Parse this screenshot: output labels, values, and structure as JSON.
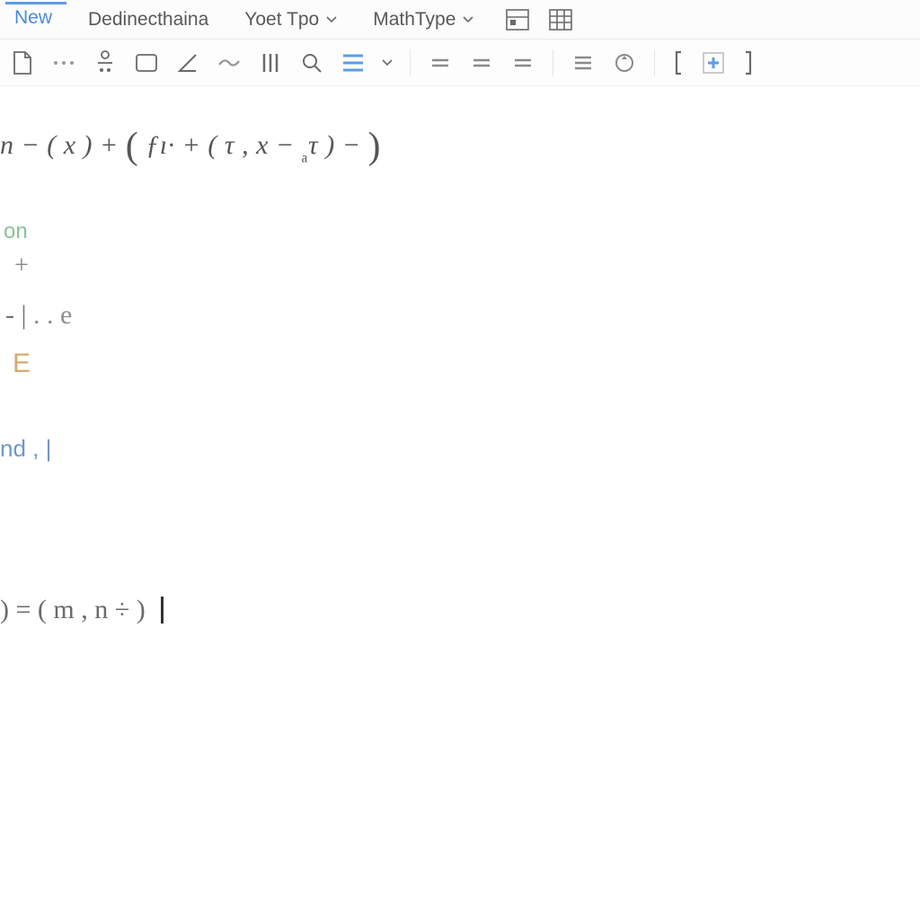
{
  "menubar": {
    "items": [
      {
        "label": "New",
        "active": true,
        "has_dropdown": false
      },
      {
        "label": "Dedinecthaina",
        "active": false,
        "has_dropdown": false
      },
      {
        "label": "Yoet Tpo",
        "active": false,
        "has_dropdown": true
      },
      {
        "label": "MathType",
        "active": false,
        "has_dropdown": true
      }
    ],
    "right_icons": [
      "insert-row-icon",
      "table-grid-icon"
    ]
  },
  "toolbar": {
    "buttons": [
      "new-doc-icon",
      "ellipsis-icon",
      "fraction-icon",
      "bracket-icon",
      "angle-icon",
      "tilde-icon",
      "matrix-bars-icon",
      "zoom-icon",
      "align-lines-icon",
      "dropdown-caret-icon",
      "sep",
      "eq1-icon",
      "eq2-icon",
      "eq3-icon",
      "sep",
      "triple-bar-icon",
      "circle-arrow-icon",
      "sep",
      "left-bracket-icon",
      "plus-box-icon",
      "right-bracket-icon"
    ]
  },
  "editor": {
    "equation1_parts": {
      "p1": "n − ( x ) + ",
      "big_open": "(",
      "p2": " ƒı· + ( τ , x − ",
      "sub": "ₐ",
      "p3": "τ ) − ",
      "big_close": ")"
    },
    "label_on": "on",
    "label_plus": "+",
    "label_minus1e_a": "- |",
    "label_minus1e_b": ". . e",
    "label_E": "E",
    "label_nd": "nd ,  |",
    "equation2_parts": {
      "p1": ") = ( m , n ÷ ) "
    }
  }
}
